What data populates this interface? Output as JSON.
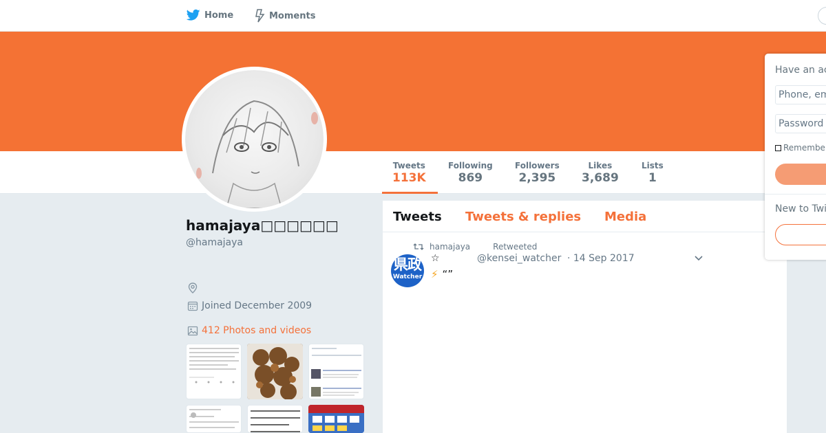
{
  "nav": {
    "home_label": "Home",
    "moments_label": "Moments"
  },
  "colors": {
    "theme": "#f4713a",
    "banner": "#f47234",
    "page_bg": "#e6ecf0",
    "text_muted": "#657786"
  },
  "stats": [
    {
      "label": "Tweets",
      "value": "113K",
      "active": true
    },
    {
      "label": "Following",
      "value": "869"
    },
    {
      "label": "Followers",
      "value": "2,395"
    },
    {
      "label": "Likes",
      "value": "3,689"
    },
    {
      "label": "Lists",
      "value": "1"
    }
  ],
  "profile": {
    "name": "hamajaya□□□□□□",
    "handle": "@hamajaya",
    "joined": "Joined December 2009",
    "photos_link": "412 Photos and videos"
  },
  "timeline": {
    "tabs": [
      "Tweets",
      "Tweets & replies",
      "Media"
    ],
    "tweet": {
      "retweeter": "hamajaya",
      "retweet_label": "Retweeted",
      "display_name": "☆",
      "screen_name": "@kensei_watcher",
      "date": "· 14 Sep 2017",
      "text": "“”",
      "avatar_big": "県政",
      "avatar_small": "Watcher"
    }
  },
  "login": {
    "title": "Have an account?",
    "username_placeholder": "Phone, email or username",
    "password_placeholder": "Password",
    "remember_label": "Remember me",
    "new_label": "New to Twitter?"
  },
  "icons": [
    "twitter-bird-icon",
    "lightning-icon",
    "location-pin-icon",
    "calendar-icon",
    "photo-icon",
    "retweet-icon",
    "caret-down-icon",
    "bolt-emoji-icon"
  ]
}
